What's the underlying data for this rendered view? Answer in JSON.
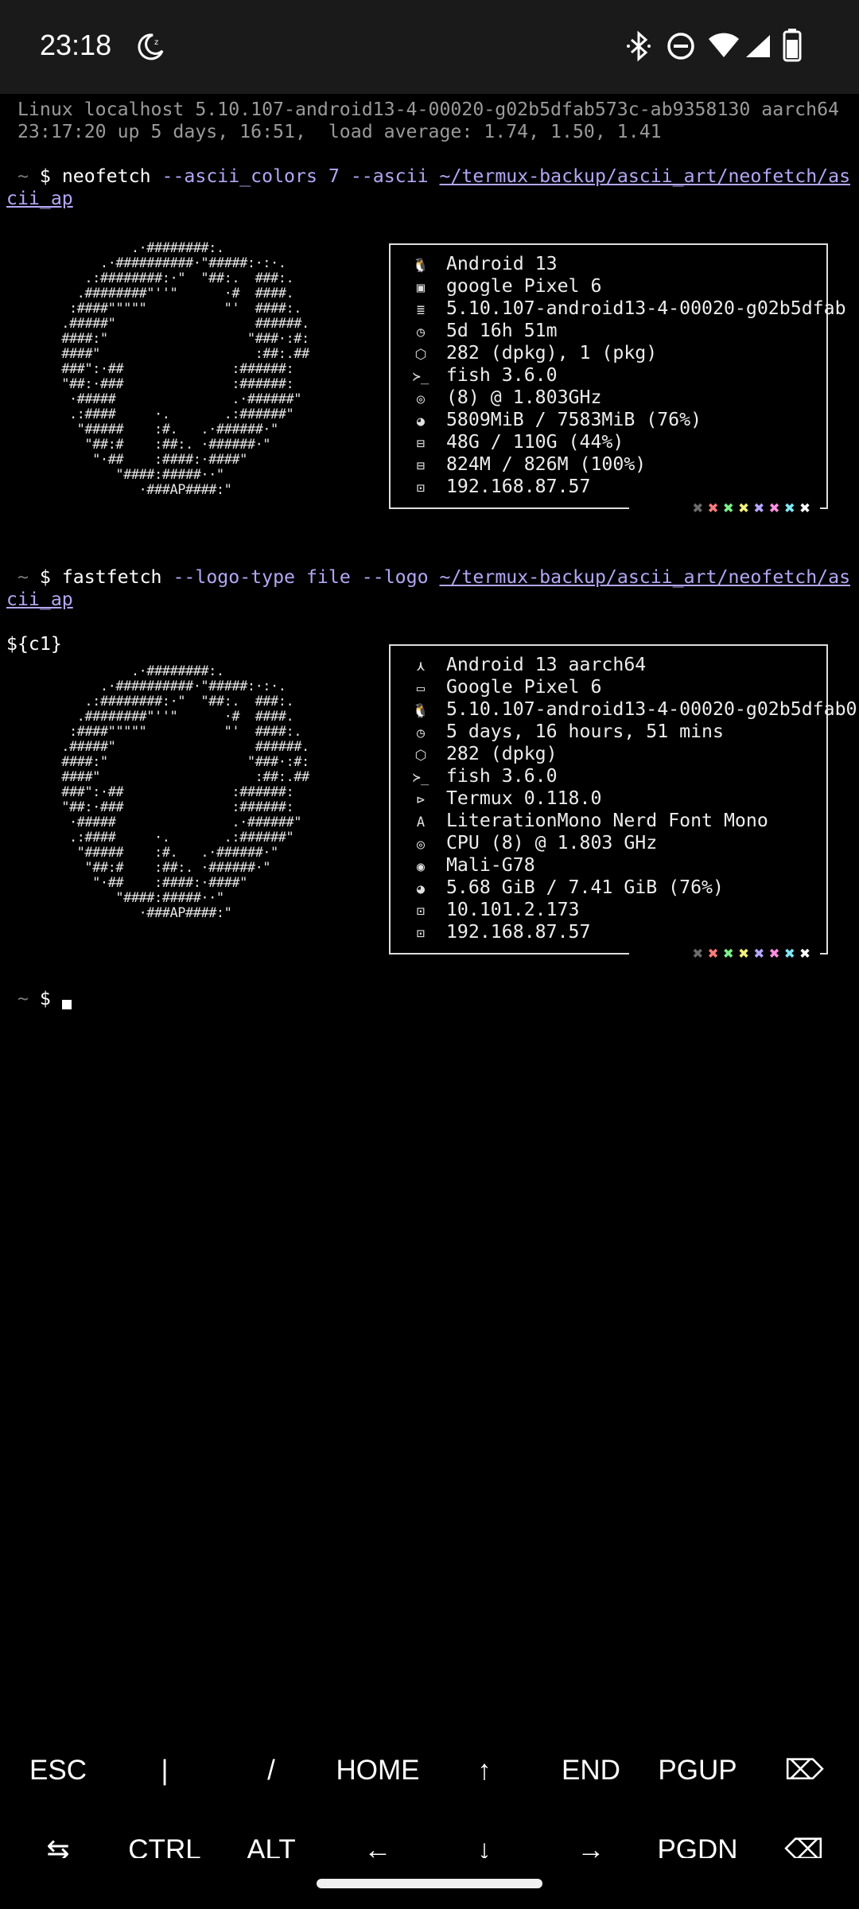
{
  "status_bar": {
    "time": "23:18",
    "icons": [
      "moon-icon",
      "bluetooth-icon",
      "dnd-icon",
      "wifi-icon",
      "signal-icon",
      "battery-icon"
    ]
  },
  "terminal": {
    "motd_line1": " Linux localhost 5.10.107-android13-4-00020-g02b5dfab573c-ab9358130 aarch64",
    "motd_line2": " 23:17:20 up 5 days, 16:51,  load average: 1.74, 1.50, 1.41",
    "prompt_tilde": "~",
    "prompt_dollar": "$",
    "cmd1": {
      "name": "neofetch",
      "args": "--ascii_colors 7 --ascii",
      "path_part1": "~/termux-backup/ascii_art/neofetch/as",
      "path_part2": "cii_ap"
    },
    "neofetch_info": [
      {
        "icon": "linux-icon",
        "glyph": "🐧",
        "text": "Android 13"
      },
      {
        "icon": "phone-icon",
        "glyph": "▣",
        "text": "google Pixel 6"
      },
      {
        "icon": "kernel-icon",
        "glyph": "≣",
        "text": "5.10.107-android13-4-00020-g02b5dfab"
      },
      {
        "icon": "clock-icon",
        "glyph": "◷",
        "text": "5d 16h 51m"
      },
      {
        "icon": "package-icon",
        "glyph": "⬡",
        "text": "282 (dpkg), 1 (pkg)"
      },
      {
        "icon": "terminal-icon",
        "glyph": "≻_",
        "text": "fish 3.6.0"
      },
      {
        "icon": "cpu-icon",
        "glyph": "◎",
        "text": "(8) @ 1.803GHz"
      },
      {
        "icon": "memory-icon",
        "glyph": "◕",
        "text": "5809MiB / 7583MiB (76%)"
      },
      {
        "icon": "disk-icon",
        "glyph": "⊟",
        "text": "48G / 110G (44%)"
      },
      {
        "icon": "disk-icon",
        "glyph": "⊟",
        "text": "824M / 826M (100%)"
      },
      {
        "icon": "network-icon",
        "glyph": "⊡",
        "text": "192.168.87.57"
      }
    ],
    "cmd2": {
      "name": "fastfetch",
      "args": "--logo-type file --logo",
      "path_part1": "~/termux-backup/ascii_art/neofetch/as",
      "path_part2": "cii_ap"
    },
    "c1_literal": "${c1}",
    "fastfetch_info": [
      {
        "icon": "os-icon",
        "glyph": "⋏",
        "text": "Android 13 aarch64"
      },
      {
        "icon": "host-icon",
        "glyph": "▭",
        "text": "Google Pixel 6"
      },
      {
        "icon": "linux-icon",
        "glyph": "🐧",
        "text": "5.10.107-android13-4-00020-g02b5dfab0"
      },
      {
        "icon": "clock-icon",
        "glyph": "◷",
        "text": "5 days, 16 hours, 51 mins"
      },
      {
        "icon": "package-icon",
        "glyph": "⬡",
        "text": "282 (dpkg)"
      },
      {
        "icon": "terminal-icon",
        "glyph": "≻_",
        "text": "fish 3.6.0"
      },
      {
        "icon": "terminal-app-icon",
        "glyph": "⊳",
        "text": "Termux 0.118.0"
      },
      {
        "icon": "font-icon",
        "glyph": "A",
        "text": "LiterationMono Nerd Font Mono"
      },
      {
        "icon": "cpu-icon",
        "glyph": "◎",
        "text": "CPU (8) @ 1.803 GHz"
      },
      {
        "icon": "gpu-icon",
        "glyph": "◉",
        "text": "Mali-G78"
      },
      {
        "icon": "memory-icon",
        "glyph": "◕",
        "text": "5.68 GiB / 7.41 GiB (76%)"
      },
      {
        "icon": "network-icon",
        "glyph": "⊡",
        "text": "10.101.2.173"
      },
      {
        "icon": "network-icon",
        "glyph": "⊡",
        "text": "192.168.87.57"
      }
    ],
    "logo_label": "AP",
    "swatch_glyph": "✖",
    "swatch_colors": [
      "#6b6b6b",
      "#ff7b7b",
      "#7cf08a",
      "#f4f07a",
      "#b7a6ff",
      "#ff8fe0",
      "#7fe8f4",
      "#ffffff"
    ]
  },
  "extra_keys": {
    "row1": [
      "ESC",
      "|",
      "/",
      "HOME",
      "↑",
      "END",
      "PGUP",
      "⌦"
    ],
    "row2": [
      "⇆",
      "CTRL",
      "ALT",
      "←",
      "↓",
      "→",
      "PGDN",
      "⌫"
    ]
  }
}
